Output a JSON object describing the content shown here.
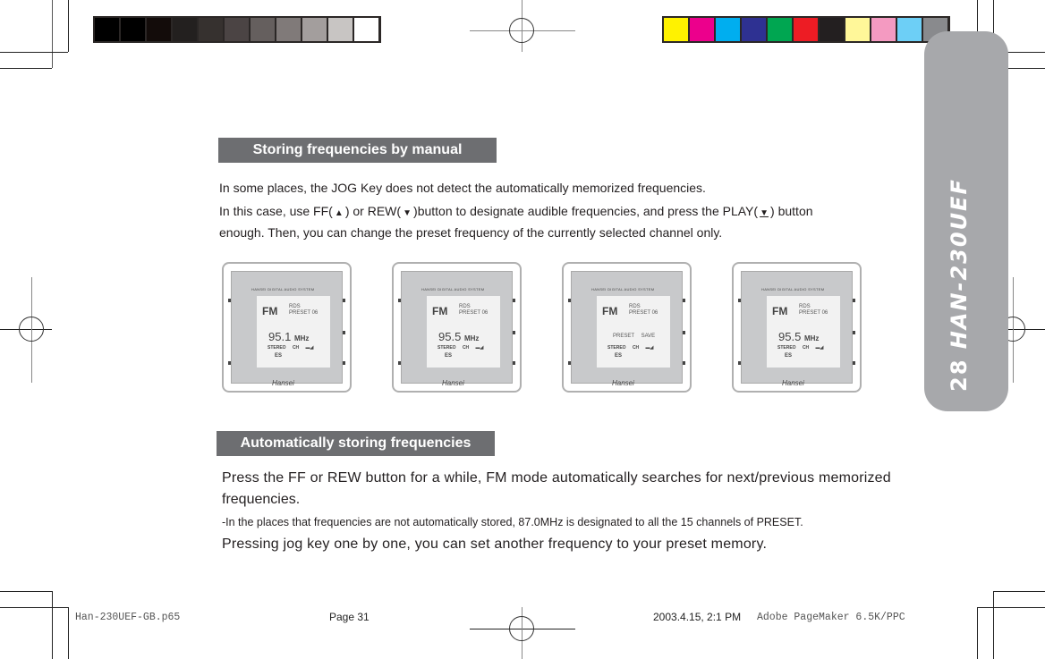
{
  "color_bars": {
    "grayscale": [
      "#000000",
      "#000000",
      "#130c0a",
      "#23201f",
      "#36312f",
      "#4b4444",
      "#655f5e",
      "#807a79",
      "#a39e9d",
      "#c8c5c3",
      "#ffffff"
    ],
    "process": [
      "#fff200",
      "#ec008c",
      "#00aeef",
      "#2e3192",
      "#00a651",
      "#ed1c24",
      "#231f20",
      "#fff799",
      "#f49ac1",
      "#6dcff6",
      "#898a8d"
    ]
  },
  "side_tab": {
    "page_number": "28",
    "model": "HAN-230UEF",
    "color": "#a7a8ab"
  },
  "section1": {
    "title": "Storing frequencies by manual",
    "line1": "In some places, the JOG Key does not detect the automatically memorized frequencies.",
    "line2_a": "In this case, use FF(",
    "ff_icon": "▲",
    "line2_b": ") or REW(",
    "rew_icon": "▼",
    "line2_c": ")button to designate audible frequencies, and press the PLAY(",
    "play_icon": "▼",
    "line2_d": ") button",
    "line3": "enough. Then, you can change the preset frequency of the currently selected channel only."
  },
  "devices": [
    {
      "header": "HANSEI  DIGITAL AUDIO SYSTEM",
      "mode": "FM",
      "preset": "RDS",
      "preset2": "PRESET 06",
      "freq": "95.1",
      "unit": "MHz",
      "status": "STEREO CH  ▬◢",
      "ch": "ES",
      "brand": "Hansei"
    },
    {
      "header": "HANSEI  DIGITAL AUDIO SYSTEM",
      "mode": "FM",
      "preset": "RDS",
      "preset2": "PRESET 06",
      "freq": "95.5",
      "unit": "MHz",
      "status": "STEREO CH  ▬◢",
      "ch": "ES",
      "brand": "Hansei"
    },
    {
      "header": "HANSEI  DIGITAL AUDIO SYSTEM",
      "mode": "FM",
      "preset": "RDS",
      "preset2": "PRESET 06",
      "save": "PRESET  SAVE",
      "status": "STEREO CH  ▬◢",
      "ch": "ES",
      "brand": "Hansei"
    },
    {
      "header": "HANSEI  DIGITAL AUDIO SYSTEM",
      "mode": "FM",
      "preset": "RDS",
      "preset2": "PRESET 06",
      "freq": "95.5",
      "unit": "MHz",
      "status": "STEREO CH  ▬◢",
      "ch": "ES",
      "brand": "Hansei"
    }
  ],
  "section2": {
    "title": "Automatically storing frequencies",
    "line1": "Press the FF or REW button for a while, FM mode automatically searches for next/previous memorized",
    "line2": "frequencies.",
    "note": "-In the places that frequencies are not automatically stored, 87.0MHz is designated to all the 15 channels of PRESET.",
    "line3": "Pressing jog key one by one, you can set another frequency to your preset memory."
  },
  "footer": {
    "filename": "Han-230UEF-GB.p65",
    "page": "Page 31",
    "datetime": "2003.4.15, 2:1 PM",
    "app": "Adobe PageMaker 6.5K/PPC"
  }
}
